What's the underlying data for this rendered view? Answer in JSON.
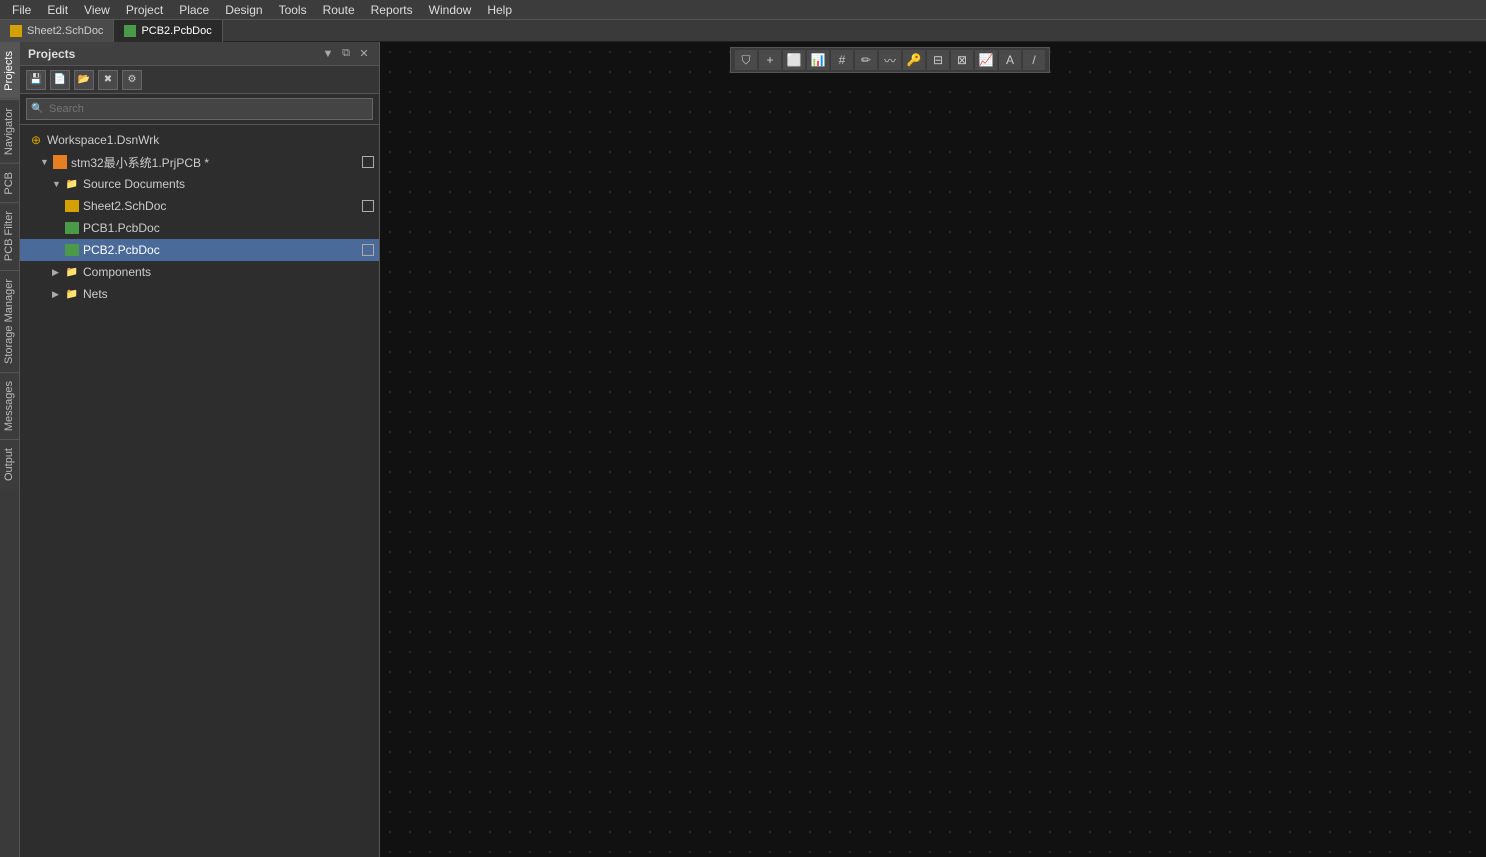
{
  "menubar": {
    "items": [
      "File",
      "Edit",
      "View",
      "Project",
      "Place",
      "Design",
      "Tools",
      "Route",
      "Reports",
      "Window",
      "Help"
    ]
  },
  "tabs": [
    {
      "label": "Sheet2.SchDoc",
      "type": "sch",
      "active": false
    },
    {
      "label": "PCB2.PcbDoc",
      "type": "pcb",
      "active": true
    }
  ],
  "projects_panel": {
    "title": "Projects",
    "toolbar": {
      "save_label": "💾",
      "new_label": "📄",
      "open_label": "📂",
      "close_label": "✖",
      "settings_label": "⚙"
    },
    "search_placeholder": "Search"
  },
  "file_tree": {
    "workspace": "Workspace1.DsnWrk",
    "project": "stm32最小系统1.PrjPCB *",
    "source_documents_label": "Source Documents",
    "files": [
      {
        "name": "Sheet2.SchDoc",
        "type": "sch",
        "dirty": true
      },
      {
        "name": "PCB1.PcbDoc",
        "type": "pcb",
        "dirty": false
      },
      {
        "name": "PCB2.PcbDoc",
        "type": "pcb",
        "dirty": true,
        "selected": true
      }
    ],
    "components_label": "Components",
    "nets_label": "Nets"
  },
  "left_vtabs": [
    "Projects",
    "Navigator",
    "PCB",
    "PCB Filter",
    "Storage Manager",
    "Messages",
    "Output"
  ],
  "right_toolbar_icons": [
    "⛉",
    "+",
    "⊡",
    "📊",
    "⊞",
    "✏",
    "〰",
    "🔑",
    "⊟",
    "⊠",
    "📈",
    "A",
    "/"
  ]
}
